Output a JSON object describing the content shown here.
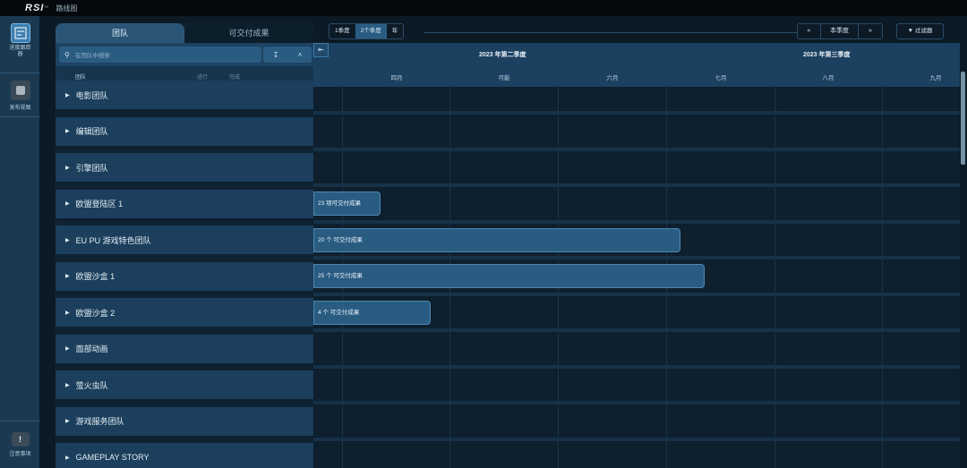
{
  "topbar": {
    "logo": "RSI",
    "logo_mark": "™",
    "app_title": "路线图"
  },
  "rail": {
    "items": [
      {
        "label": "进度跟踪器",
        "icon": "progress-tracker-icon",
        "active": true
      },
      {
        "label": "发布视图",
        "icon": "release-view-icon",
        "active": false
      }
    ],
    "bottom": {
      "label": "注意事项",
      "icon": "warning-icon"
    }
  },
  "panel": {
    "tabs": [
      "团队",
      "可交付成果"
    ],
    "active_tab": 0,
    "search_placeholder": "在团队中搜索",
    "columns": [
      "团队",
      "进行",
      "完成"
    ]
  },
  "teams": [
    "电影团队",
    "编辑团队",
    "引擎团队",
    "欧盟登陆区 1",
    "EU PU 游戏特色团队",
    "欧盟沙盒 1",
    "欧盟沙盒 2",
    "面部动画",
    "萤火虫队",
    "游戏服务团队",
    "GAMEPLAY STORY"
  ],
  "toolbar": {
    "range_options": [
      "1季度",
      "2个季度",
      "年"
    ],
    "selected_range": 1,
    "current_quarter_label": "本季度",
    "filter_label": "过滤器"
  },
  "timeline": {
    "quarters": [
      "2023 年第二季度",
      "2023 年第三季度"
    ],
    "months": [
      "四月",
      "可能",
      "六月",
      "七月",
      "八月",
      "九月"
    ],
    "bars": [
      {
        "row": 3,
        "label": "23 项可交付成果"
      },
      {
        "row": 4,
        "label": "20 个 可交付成果"
      },
      {
        "row": 5,
        "label": "25 个 可交付成果"
      },
      {
        "row": 6,
        "label": "4 个 可交付成果"
      }
    ]
  },
  "colors": {
    "background": "#0c1a26",
    "panel_row": "#1b3f5c",
    "accent": "#2a5c82",
    "bar_border": "#4d86b1"
  }
}
